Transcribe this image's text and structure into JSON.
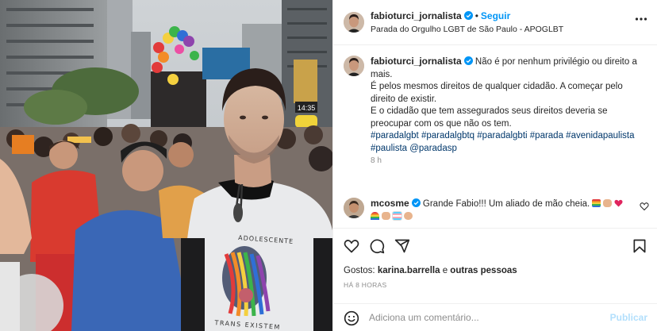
{
  "post": {
    "username": "fabioturci_jornalista",
    "follow_label": "Seguir",
    "separator": "•",
    "location": "Parada do Orgulho LGBT de São Paulo - APOGLBT"
  },
  "photo": {
    "shirt_text_top": "ADOLESCENTE",
    "shirt_text_bottom": "TRANS EXISTEM",
    "sign_text": "14:35"
  },
  "caption": {
    "username": "fabioturci_jornalista",
    "line1": "Não é por nenhum privilégio ou direito a mais.",
    "line2": "É pelos mesmos direitos de qualquer cidadão. A começar pelo direito de existir.",
    "line3": "E o cidadão que tem assegurados seus direitos deveria se preocupar com os que não os tem.",
    "hashtags": "#paradalgbt #paradalgbtq #paradalgbti #parada #avenidapaulista #paulista @paradasp",
    "time": "8 h"
  },
  "comment": {
    "username": "mcosme",
    "text": "Grande Fabio!!! Um aliado de mão cheia."
  },
  "likes": {
    "prefix": "Gostos:",
    "user": "karina.barrella",
    "conjunction": "e",
    "others": "outras pessoas"
  },
  "timestamp": "HÁ 8 HORAS",
  "composer": {
    "placeholder": "Adiciona um comentário...",
    "post_label": "Publicar"
  },
  "colors": {
    "link_blue": "#0095f6",
    "hashtag_blue": "#00376b",
    "muted": "#8e8e8e",
    "heart_red": "#ed4956",
    "verified_blue": "#0095f6"
  },
  "icons": [
    "more-options-icon",
    "verified-badge-icon",
    "heart-icon",
    "comment-icon",
    "share-icon",
    "bookmark-icon",
    "emoji-icon"
  ]
}
